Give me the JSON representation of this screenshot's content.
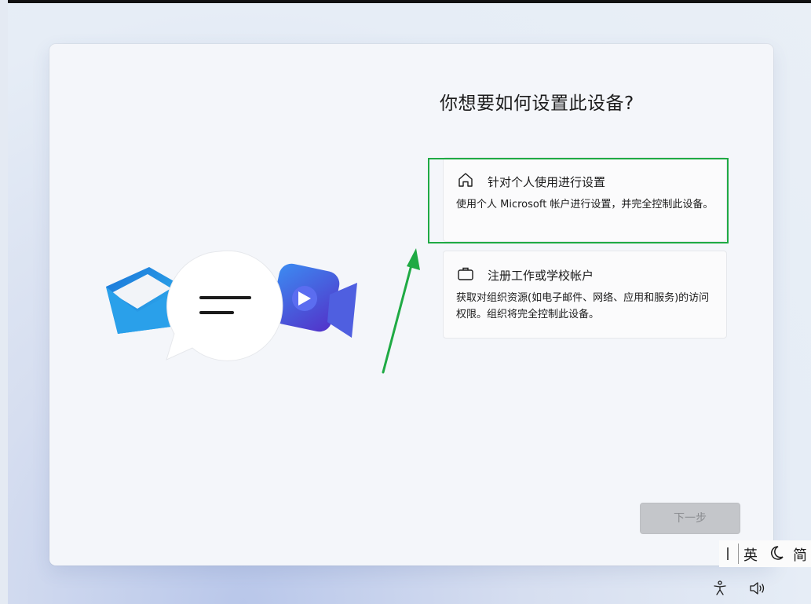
{
  "title": "你想要如何设置此设备?",
  "options": [
    {
      "icon": "home-icon",
      "title": "针对个人使用进行设置",
      "description": "使用个人 Microsoft 帐户进行设置，并完全控制此设备。"
    },
    {
      "icon": "briefcase-icon",
      "title": "注册工作或学校帐户",
      "description": "获取对组织资源(如电子邮件、网络、应用和服务)的访问权限。组织将完全控制此设备。"
    }
  ],
  "next_button": "下一步",
  "ime": {
    "language": "英",
    "script": "简"
  },
  "colors": {
    "highlight": "#1faa44",
    "arrow": "#1faa44"
  }
}
